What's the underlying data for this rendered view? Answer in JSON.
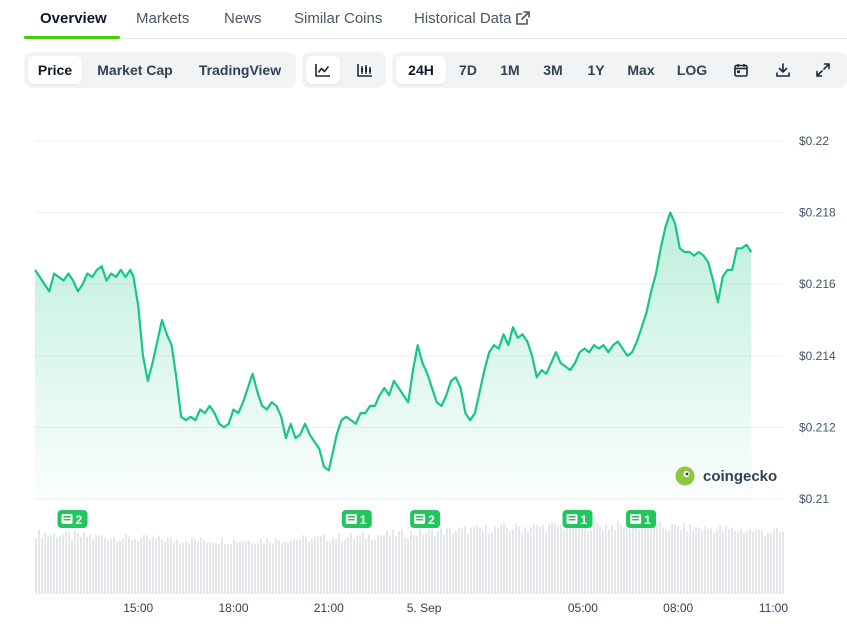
{
  "tabs": [
    {
      "label": "Overview",
      "active": true
    },
    {
      "label": "Markets"
    },
    {
      "label": "News"
    },
    {
      "label": "Similar Coins"
    },
    {
      "label": "Historical Data",
      "icon": "external-link-icon"
    }
  ],
  "toolbar": {
    "metric_tabs": [
      {
        "label": "Price",
        "selected": true
      },
      {
        "label": "Market Cap"
      },
      {
        "label": "TradingView"
      }
    ],
    "chart_type_buttons": [
      {
        "icon": "line-chart-icon",
        "selected": true
      },
      {
        "icon": "candlestick-chart-icon"
      }
    ],
    "ranges": [
      {
        "label": "24H",
        "selected": true
      },
      {
        "label": "7D"
      },
      {
        "label": "1M"
      },
      {
        "label": "3M"
      },
      {
        "label": "1Y"
      },
      {
        "label": "Max"
      },
      {
        "label": "LOG"
      }
    ],
    "tool_icons": [
      "calendar-icon",
      "download-icon",
      "fullscreen-icon"
    ]
  },
  "watermark": {
    "text": "coingecko",
    "icon": "coingecko-logo-icon"
  },
  "colors": {
    "line": "#16c784",
    "accent": "#4bcc00",
    "badge": "#22c55e",
    "volume": "#e5e7eb"
  },
  "chart_data": {
    "type": "area",
    "ylim": [
      0.21,
      0.22
    ],
    "y_ticks": [
      "$0.21",
      "$0.212",
      "$0.214",
      "$0.216",
      "$0.218",
      "$0.22"
    ],
    "x_ticks": [
      "15:00",
      "18:00",
      "21:00",
      "5. Sep",
      "05:00",
      "08:00",
      "11:00"
    ],
    "x_hours_range": [
      11.75,
      35.3
    ],
    "series": [
      {
        "points": [
          [
            11.75,
            0.2164
          ],
          [
            11.9,
            0.2162
          ],
          [
            12.05,
            0.216
          ],
          [
            12.2,
            0.2158
          ],
          [
            12.35,
            0.2163
          ],
          [
            12.5,
            0.2162
          ],
          [
            12.65,
            0.2161
          ],
          [
            12.8,
            0.2163
          ],
          [
            12.95,
            0.2161
          ],
          [
            13.1,
            0.2158
          ],
          [
            13.25,
            0.216
          ],
          [
            13.4,
            0.2163
          ],
          [
            13.55,
            0.2162
          ],
          [
            13.7,
            0.2164
          ],
          [
            13.85,
            0.2165
          ],
          [
            14.0,
            0.2161
          ],
          [
            14.15,
            0.2163
          ],
          [
            14.3,
            0.2162
          ],
          [
            14.45,
            0.2164
          ],
          [
            14.6,
            0.2162
          ],
          [
            14.75,
            0.2164
          ],
          [
            14.85,
            0.2162
          ],
          [
            15.0,
            0.2154
          ],
          [
            15.15,
            0.214
          ],
          [
            15.3,
            0.2133
          ],
          [
            15.45,
            0.2138
          ],
          [
            15.6,
            0.2144
          ],
          [
            15.75,
            0.215
          ],
          [
            15.9,
            0.2146
          ],
          [
            16.05,
            0.2143
          ],
          [
            16.2,
            0.2134
          ],
          [
            16.35,
            0.2123
          ],
          [
            16.5,
            0.2122
          ],
          [
            16.65,
            0.2123
          ],
          [
            16.8,
            0.2122
          ],
          [
            16.95,
            0.2125
          ],
          [
            17.1,
            0.2124
          ],
          [
            17.25,
            0.2126
          ],
          [
            17.4,
            0.2124
          ],
          [
            17.55,
            0.2121
          ],
          [
            17.7,
            0.212
          ],
          [
            17.85,
            0.2121
          ],
          [
            18.0,
            0.2125
          ],
          [
            18.15,
            0.2124
          ],
          [
            18.3,
            0.2127
          ],
          [
            18.45,
            0.2131
          ],
          [
            18.6,
            0.2135
          ],
          [
            18.75,
            0.213
          ],
          [
            18.9,
            0.2126
          ],
          [
            19.05,
            0.2125
          ],
          [
            19.2,
            0.2127
          ],
          [
            19.35,
            0.2126
          ],
          [
            19.5,
            0.2123
          ],
          [
            19.65,
            0.2117
          ],
          [
            19.8,
            0.2121
          ],
          [
            19.95,
            0.2117
          ],
          [
            20.1,
            0.2118
          ],
          [
            20.25,
            0.2121
          ],
          [
            20.4,
            0.2118
          ],
          [
            20.55,
            0.2116
          ],
          [
            20.7,
            0.2114
          ],
          [
            20.85,
            0.2109
          ],
          [
            21.0,
            0.2108
          ],
          [
            21.1,
            0.2112
          ],
          [
            21.25,
            0.2118
          ],
          [
            21.4,
            0.2122
          ],
          [
            21.55,
            0.2123
          ],
          [
            21.7,
            0.2122
          ],
          [
            21.85,
            0.2121
          ],
          [
            22.0,
            0.2124
          ],
          [
            22.15,
            0.2124
          ],
          [
            22.3,
            0.2126
          ],
          [
            22.45,
            0.2126
          ],
          [
            22.6,
            0.2129
          ],
          [
            22.75,
            0.2131
          ],
          [
            22.9,
            0.2129
          ],
          [
            23.05,
            0.2133
          ],
          [
            23.2,
            0.2131
          ],
          [
            23.35,
            0.2129
          ],
          [
            23.5,
            0.2127
          ],
          [
            23.65,
            0.2136
          ],
          [
            23.8,
            0.2143
          ],
          [
            23.95,
            0.2138
          ],
          [
            24.1,
            0.2135
          ],
          [
            24.25,
            0.2131
          ],
          [
            24.4,
            0.2127
          ],
          [
            24.55,
            0.2126
          ],
          [
            24.7,
            0.2129
          ],
          [
            24.85,
            0.2133
          ],
          [
            25.0,
            0.2134
          ],
          [
            25.15,
            0.2131
          ],
          [
            25.3,
            0.2124
          ],
          [
            25.45,
            0.2122
          ],
          [
            25.6,
            0.2124
          ],
          [
            25.75,
            0.213
          ],
          [
            25.9,
            0.2136
          ],
          [
            26.05,
            0.2141
          ],
          [
            26.2,
            0.2143
          ],
          [
            26.35,
            0.2142
          ],
          [
            26.5,
            0.2146
          ],
          [
            26.65,
            0.2143
          ],
          [
            26.8,
            0.2148
          ],
          [
            26.95,
            0.2145
          ],
          [
            27.1,
            0.2146
          ],
          [
            27.25,
            0.2144
          ],
          [
            27.4,
            0.214
          ],
          [
            27.55,
            0.2134
          ],
          [
            27.7,
            0.2136
          ],
          [
            27.85,
            0.2135
          ],
          [
            28.0,
            0.2138
          ],
          [
            28.15,
            0.2141
          ],
          [
            28.3,
            0.2138
          ],
          [
            28.45,
            0.2137
          ],
          [
            28.6,
            0.2136
          ],
          [
            28.75,
            0.2138
          ],
          [
            28.9,
            0.2141
          ],
          [
            29.05,
            0.2142
          ],
          [
            29.2,
            0.2141
          ],
          [
            29.35,
            0.2143
          ],
          [
            29.5,
            0.2142
          ],
          [
            29.65,
            0.2143
          ],
          [
            29.8,
            0.2141
          ],
          [
            29.95,
            0.2143
          ],
          [
            30.1,
            0.2144
          ],
          [
            30.25,
            0.2142
          ],
          [
            30.4,
            0.214
          ],
          [
            30.55,
            0.2141
          ],
          [
            30.7,
            0.2144
          ],
          [
            30.85,
            0.2148
          ],
          [
            31.0,
            0.2152
          ],
          [
            31.15,
            0.2158
          ],
          [
            31.3,
            0.2163
          ],
          [
            31.45,
            0.217
          ],
          [
            31.6,
            0.2176
          ],
          [
            31.75,
            0.218
          ],
          [
            31.9,
            0.2177
          ],
          [
            32.05,
            0.217
          ],
          [
            32.2,
            0.2169
          ],
          [
            32.35,
            0.2169
          ],
          [
            32.5,
            0.2168
          ],
          [
            32.65,
            0.2169
          ],
          [
            32.8,
            0.2168
          ],
          [
            32.95,
            0.2166
          ],
          [
            33.1,
            0.2161
          ],
          [
            33.25,
            0.2155
          ],
          [
            33.4,
            0.2162
          ],
          [
            33.55,
            0.2164
          ],
          [
            33.7,
            0.2164
          ],
          [
            33.85,
            0.217
          ],
          [
            34.0,
            0.217
          ],
          [
            34.15,
            0.2171
          ],
          [
            34.3,
            0.2169
          ]
        ]
      }
    ],
    "news_markers": [
      {
        "x": 12.9,
        "count": "2"
      },
      {
        "x": 21.85,
        "count": "1"
      },
      {
        "x": 24.0,
        "count": "2"
      },
      {
        "x": 28.8,
        "count": "1"
      },
      {
        "x": 30.8,
        "count": "1"
      }
    ],
    "volume": {
      "level": 0.78,
      "variation": 0.12
    }
  }
}
